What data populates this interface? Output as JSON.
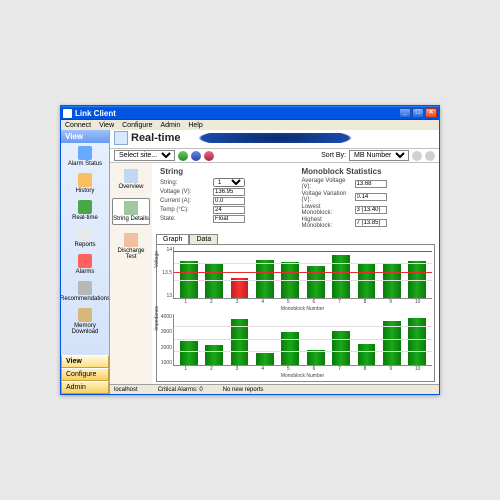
{
  "window": {
    "title": "Link Client"
  },
  "menu": {
    "connect": "Connect",
    "view": "View",
    "configure": "Configure",
    "admin": "Admin",
    "help": "Help"
  },
  "left_header": "View",
  "left_items": [
    {
      "label": "Alarm Status",
      "icon": "#68a8ff"
    },
    {
      "label": "History",
      "icon": "#f8c060"
    },
    {
      "label": "Real-time",
      "icon": "#48a848"
    },
    {
      "label": "Reports",
      "icon": "#e8e8e8"
    },
    {
      "label": "Alarms",
      "icon": "#ff6060"
    },
    {
      "label": "Recommendations",
      "icon": "#b8b8b8"
    },
    {
      "label": "Memory Download",
      "icon": "#d8b878"
    }
  ],
  "left_buttons": {
    "view": "View",
    "configure": "Configure",
    "admin": "Admin"
  },
  "main_title": "Real-time",
  "toolbar": {
    "site_label": "Select site...",
    "sort_label": "Sort By:",
    "sort_value": "MB Number"
  },
  "sec_nav": [
    {
      "label": "Overview"
    },
    {
      "label": "String Details"
    },
    {
      "label": "Discharge Test"
    }
  ],
  "string_block": {
    "title": "String",
    "rows": [
      {
        "label": "String:",
        "value": "1",
        "type": "select"
      },
      {
        "label": "Voltage (V):",
        "value": "136.95"
      },
      {
        "label": "Current (A):",
        "value": "0.0"
      },
      {
        "label": "Temp (°C):",
        "value": "24"
      },
      {
        "label": "State:",
        "value": "Float"
      }
    ]
  },
  "mono_block": {
    "title": "Monoblock Statistics",
    "rows": [
      {
        "label": "Average Voltage (V):",
        "value": "13.68"
      },
      {
        "label": "Voltage Variation (V):",
        "value": "0.14"
      },
      {
        "label": "Lowest Monoblock:",
        "value": "3 (13.40)"
      },
      {
        "label": "Highest Monoblock:",
        "value": "7 (13.85)"
      }
    ]
  },
  "tabs": {
    "graph": "Graph",
    "data": "Data"
  },
  "chart_data": [
    {
      "type": "bar",
      "title": "",
      "ylabel": "Voltage",
      "xlabel": "Monoblock Number",
      "categories": [
        "1",
        "2",
        "3",
        "4",
        "5",
        "6",
        "7",
        "8",
        "9",
        "10"
      ],
      "values": [
        13.72,
        13.69,
        13.4,
        13.75,
        13.7,
        13.62,
        13.85,
        13.66,
        13.68,
        13.72
      ],
      "alert_index": 2,
      "ylim": [
        13.0,
        14.0
      ],
      "ref_lines": [
        13.5,
        13.9
      ]
    },
    {
      "type": "bar",
      "title": "",
      "ylabel": "Impedance",
      "xlabel": "Monoblock Number",
      "categories": [
        "1",
        "2",
        "3",
        "4",
        "5",
        "6",
        "7",
        "8",
        "9",
        "10"
      ],
      "values": [
        2400,
        2150,
        3700,
        1700,
        2950,
        1900,
        3000,
        2250,
        3600,
        3750
      ],
      "ylim": [
        1000,
        4000
      ]
    }
  ],
  "statusbar": {
    "field1": "localhost",
    "field2": "Critical Alarms: 0",
    "field3": "No new reports"
  }
}
